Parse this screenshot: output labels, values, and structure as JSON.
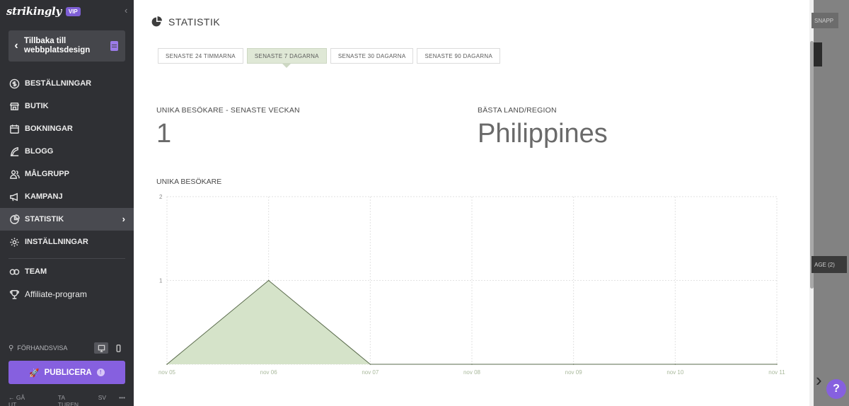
{
  "brand": {
    "logo": "strikingly",
    "badge": "VIP"
  },
  "sidebar": {
    "back_label": "Tillbaka till webbplatsdesign",
    "items": [
      {
        "label": "BESTÄLLNINGAR",
        "icon": "dollar-circle-icon"
      },
      {
        "label": "BUTIK",
        "icon": "shop-icon"
      },
      {
        "label": "BOKNINGAR",
        "icon": "calendar-icon"
      },
      {
        "label": "BLOGG",
        "icon": "feather-icon"
      },
      {
        "label": "MÅLGRUPP",
        "icon": "users-icon"
      },
      {
        "label": "KAMPANJ",
        "icon": "megaphone-icon"
      },
      {
        "label": "STATISTIK",
        "icon": "pie-chart-icon",
        "active": true
      },
      {
        "label": "INSTÄLLNINGAR",
        "icon": "gear-icon"
      }
    ],
    "team_label": "TEAM",
    "affiliate_label": "Affiliate-program",
    "preview_label": "FÖRHANDSVISA",
    "publish_label": "PUBLICERA",
    "footer": {
      "exit": "GÅ UT",
      "tour": "TA TUREN",
      "lang": "SV",
      "more": "•••"
    }
  },
  "main": {
    "title": "STATISTIK",
    "tabs": [
      {
        "label": "SENASTE 24 TIMMARNA",
        "active": false
      },
      {
        "label": "SENASTE 7 DAGARNA",
        "active": true
      },
      {
        "label": "SENASTE 30 DAGARNA",
        "active": false
      },
      {
        "label": "SENASTE 90 DAGARNA",
        "active": false
      }
    ],
    "unique_label": "UNIKA BESÖKARE - SENASTE VECKAN",
    "unique_value": "1",
    "country_label": "BÄSTA LAND/REGION",
    "country_value": "Philippines",
    "chart_label": "UNIKA BESÖKARE"
  },
  "chart_data": {
    "type": "area",
    "categories": [
      "nov 05",
      "nov 06",
      "nov 07",
      "nov 08",
      "nov 09",
      "nov 10",
      "nov 11"
    ],
    "values": [
      0,
      1,
      0,
      0,
      0,
      0,
      0
    ],
    "ylim": [
      0,
      2
    ],
    "yticks": [
      "1",
      "2"
    ],
    "grid": true
  },
  "backdrop": {
    "chip1": "SNAPP",
    "chip2": "AGE (2)"
  },
  "colors": {
    "accent": "#8660df",
    "sidebar": "#2f3034",
    "area_fill": "#d5e3c9",
    "area_line": "#5a6b4c"
  }
}
